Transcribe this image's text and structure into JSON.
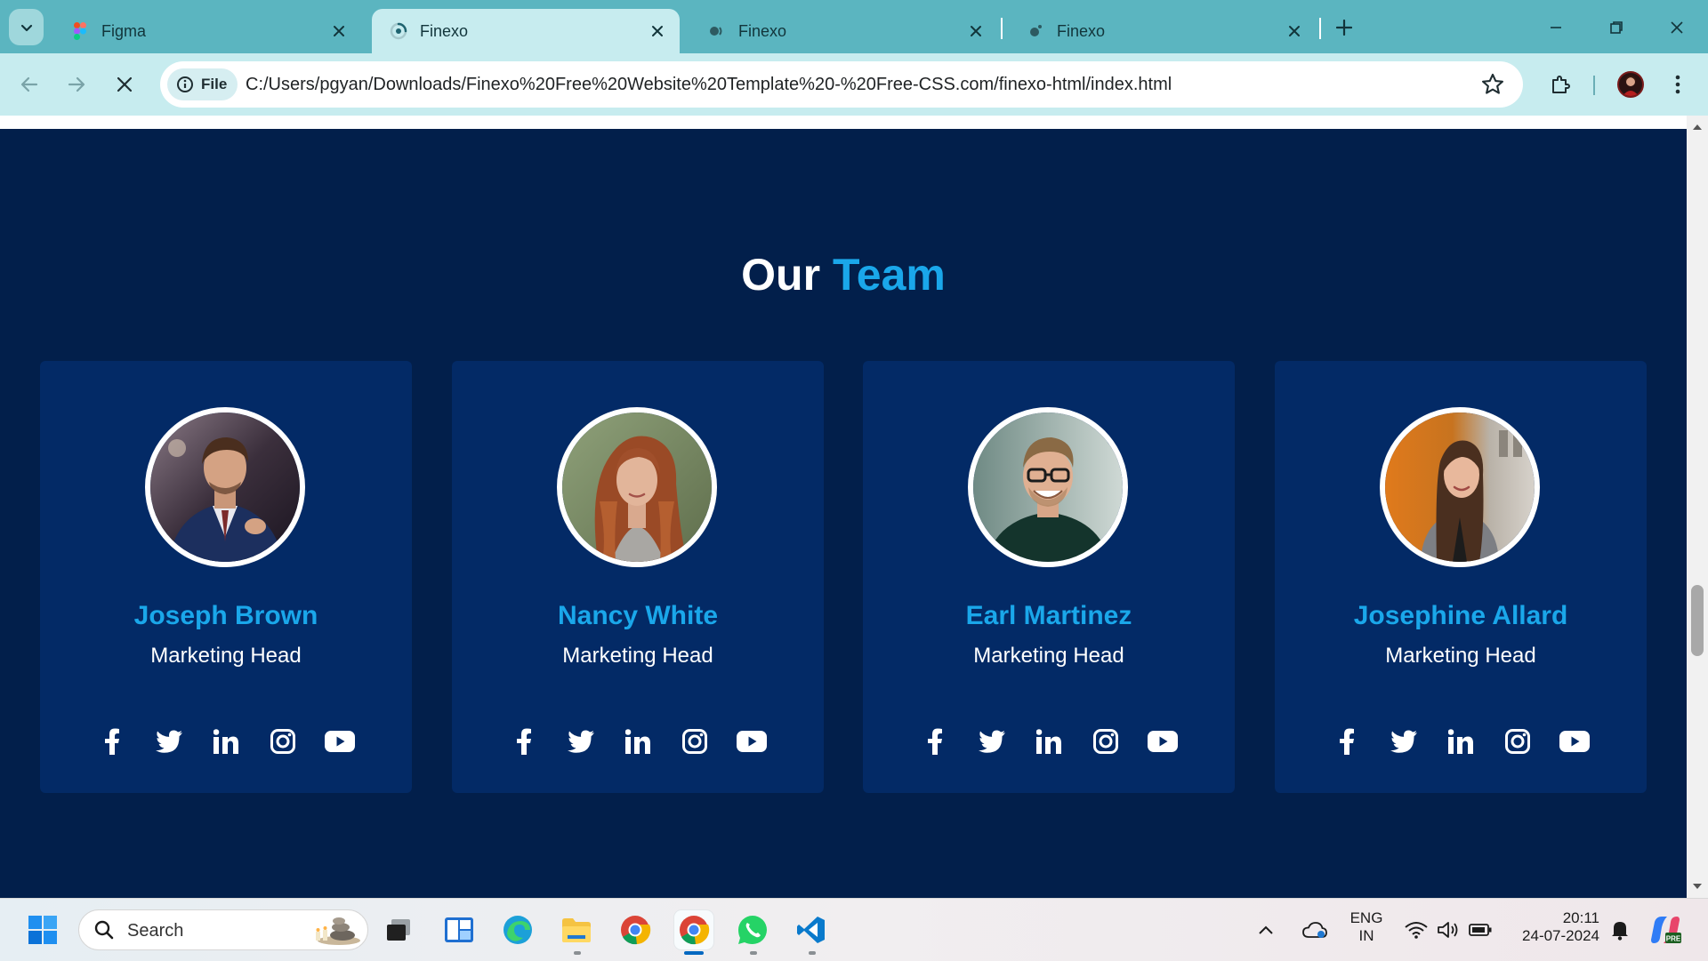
{
  "browser": {
    "tabs": [
      {
        "title": "Figma",
        "active": false
      },
      {
        "title": "Finexo",
        "active": true
      },
      {
        "title": "Finexo",
        "active": false
      },
      {
        "title": "Finexo",
        "active": false
      }
    ],
    "site_info_label": "File",
    "url": "C:/Users/pgyan/Downloads/Finexo%20Free%20Website%20Template%20-%20Free-CSS.com/finexo-html/index.html"
  },
  "page": {
    "section_title_main": "Our",
    "section_title_accent": "Team",
    "accent_color": "#1aa7ea",
    "background_color": "#021f4b",
    "card_color": "#032a66",
    "team": [
      {
        "name": "Joseph Brown",
        "role": "Marketing Head",
        "photo_icon": "man-in-suit-photo"
      },
      {
        "name": "Nancy White",
        "role": "Marketing Head",
        "photo_icon": "woman-red-hair-photo"
      },
      {
        "name": "Earl Martinez",
        "role": "Marketing Head",
        "photo_icon": "man-with-glasses-photo"
      },
      {
        "name": "Josephine Allard",
        "role": "Marketing Head",
        "photo_icon": "woman-blazer-photo"
      }
    ],
    "social_icons": [
      "facebook-icon",
      "twitter-icon",
      "linkedin-icon",
      "instagram-icon",
      "youtube-icon"
    ]
  },
  "taskbar": {
    "search_placeholder": "Search",
    "language_line1": "ENG",
    "language_line2": "IN",
    "time": "20:11",
    "date": "24-07-2024"
  }
}
